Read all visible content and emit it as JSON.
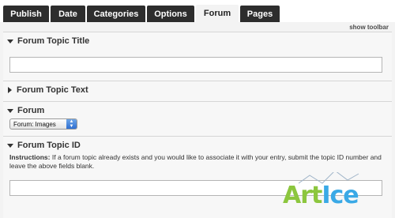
{
  "tabs": [
    {
      "label": "Publish"
    },
    {
      "label": "Date"
    },
    {
      "label": "Categories"
    },
    {
      "label": "Options"
    },
    {
      "label": "Forum",
      "active": true
    },
    {
      "label": "Pages"
    }
  ],
  "show_toolbar": "show toolbar",
  "sections": {
    "forum_topic_title": {
      "heading": "Forum Topic Title",
      "value": ""
    },
    "forum_topic_text": {
      "heading": "Forum Topic Text"
    },
    "forum": {
      "heading": "Forum",
      "selected": "Forum: Images"
    },
    "forum_topic_id": {
      "heading": "Forum Topic ID",
      "instructions_label": "Instructions:",
      "instructions_text": "If a forum topic already exists and you would like to associate it with your entry, submit the topic ID number and leave the above fields blank.",
      "value": ""
    }
  },
  "watermark": {
    "text_a": "Art",
    "text_b": "Ice"
  },
  "colors": {
    "tab_bg": "#2d2d2d",
    "tab_active_bg": "#f3f3f3",
    "page_bg": "#f3f3f3",
    "watermark_green": "#8cc63e",
    "watermark_blue": "#3aa9e6"
  }
}
